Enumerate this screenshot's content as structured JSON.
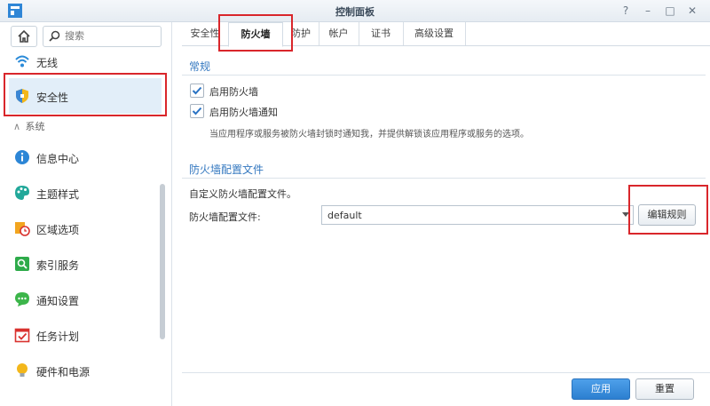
{
  "window": {
    "title": "控制面板",
    "controls": [
      "?",
      "–",
      "□",
      "✕"
    ]
  },
  "search": {
    "placeholder": "搜索"
  },
  "sidebar": {
    "top_items": [
      {
        "label": "无线",
        "icon": "wifi-icon"
      },
      {
        "label": "安全性",
        "icon": "shield-icon",
        "active": true
      }
    ],
    "section": {
      "label": "系统"
    },
    "items": [
      {
        "label": "信息中心",
        "icon": "info-icon"
      },
      {
        "label": "主题样式",
        "icon": "palette-icon"
      },
      {
        "label": "区域选项",
        "icon": "region-clock-icon"
      },
      {
        "label": "索引服务",
        "icon": "index-search-icon"
      },
      {
        "label": "通知设置",
        "icon": "chat-bubble-icon"
      },
      {
        "label": "任务计划",
        "icon": "calendar-check-icon"
      },
      {
        "label": "硬件和电源",
        "icon": "bulb-icon"
      }
    ]
  },
  "tabs": [
    {
      "label": "安全性"
    },
    {
      "label": "防火墙",
      "active": true
    },
    {
      "label": "防护"
    },
    {
      "label": "帐户"
    },
    {
      "label": "证书"
    },
    {
      "label": "高级设置"
    }
  ],
  "general": {
    "title": "常规",
    "enable_firewall": {
      "label": "启用防火墙",
      "checked": true
    },
    "enable_notify": {
      "label": "启用防火墙通知",
      "checked": true
    },
    "note": "当应用程序或服务被防火墙封锁时通知我，并提供解锁该应用程序或服务的选项。"
  },
  "profile": {
    "title": "防火墙配置文件",
    "description": "自定义防火墙配置文件。",
    "field_label": "防火墙配置文件:",
    "selected": "default",
    "edit_button": "编辑规则"
  },
  "footer": {
    "apply": "应用",
    "reset": "重置"
  },
  "colors": {
    "accent": "#3478c0",
    "highlight": "#d9262b",
    "primary_button": "#2c7fd0"
  }
}
